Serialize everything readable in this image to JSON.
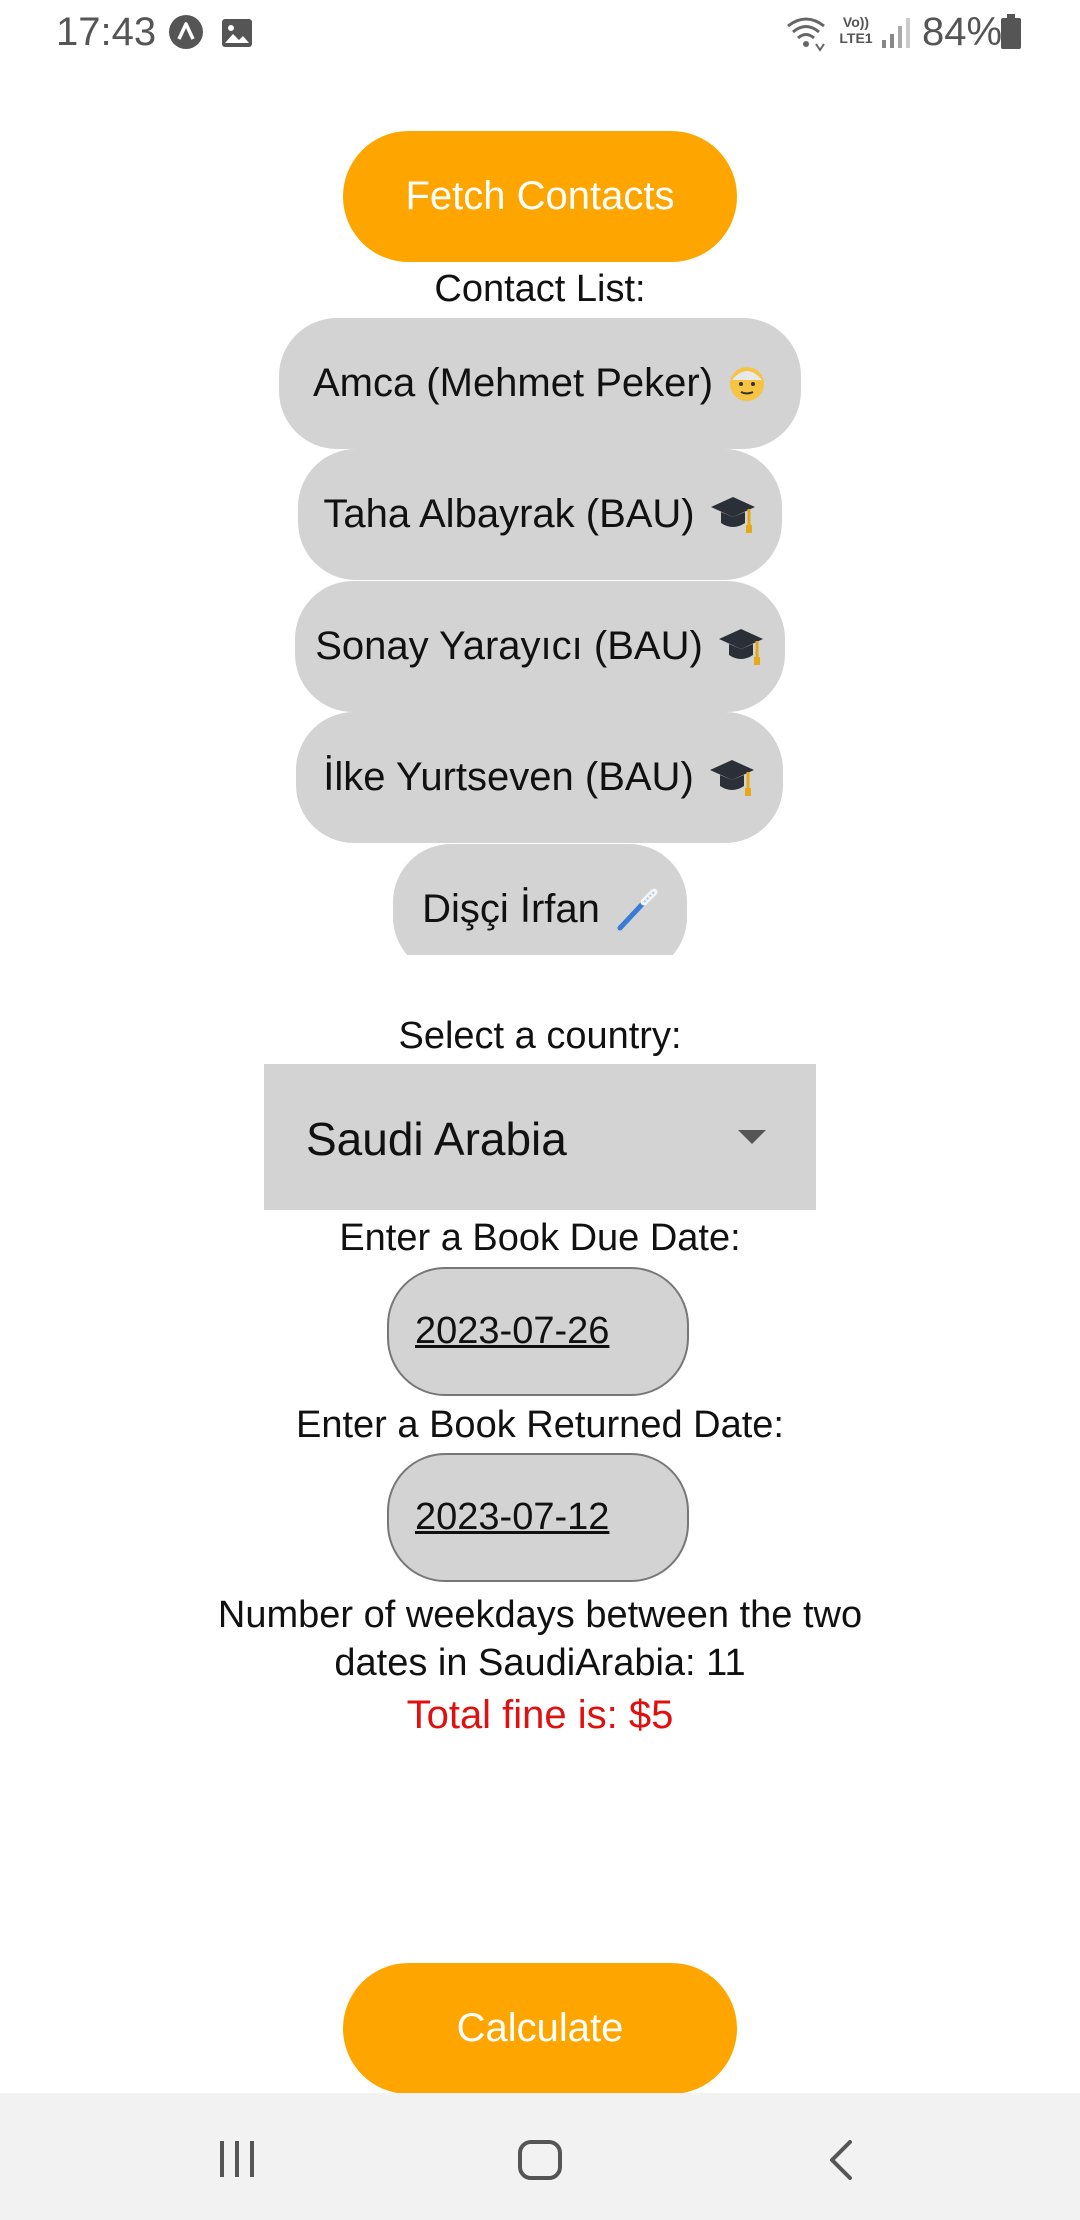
{
  "status_bar": {
    "time": "17:43",
    "volte": "Vo)) LTE1",
    "battery": "84%"
  },
  "fetch_button": "Fetch Contacts",
  "contact_list_label": "Contact List:",
  "contacts": [
    {
      "name": "Amca (Mehmet Peker)",
      "icon": "older-man-icon"
    },
    {
      "name": "Taha Albayrak (BAU)",
      "icon": "graduation-cap-icon"
    },
    {
      "name": "Sonay Yarayıcı (BAU)",
      "icon": "graduation-cap-icon"
    },
    {
      "name": "İlke Yurtseven (BAU)",
      "icon": "graduation-cap-icon"
    },
    {
      "name": "Dişçi İrfan",
      "icon": "toothbrush-icon"
    }
  ],
  "country_label": "Select a country:",
  "country_selected": "Saudi Arabia",
  "due_date_label": "Enter a Book Due Date:",
  "due_date": "2023-07-26",
  "returned_date_label": "Enter a Book Returned Date:",
  "returned_date": "2023-07-12",
  "result_line1": "Number of weekdays between the two",
  "result_line2": "dates in SaudiArabia: 11",
  "fine_text": "Total fine is: $5",
  "calculate_button": "Calculate",
  "colors": {
    "accent": "#FFA500",
    "chip": "#D3D3D3",
    "fine": "#E01010"
  }
}
